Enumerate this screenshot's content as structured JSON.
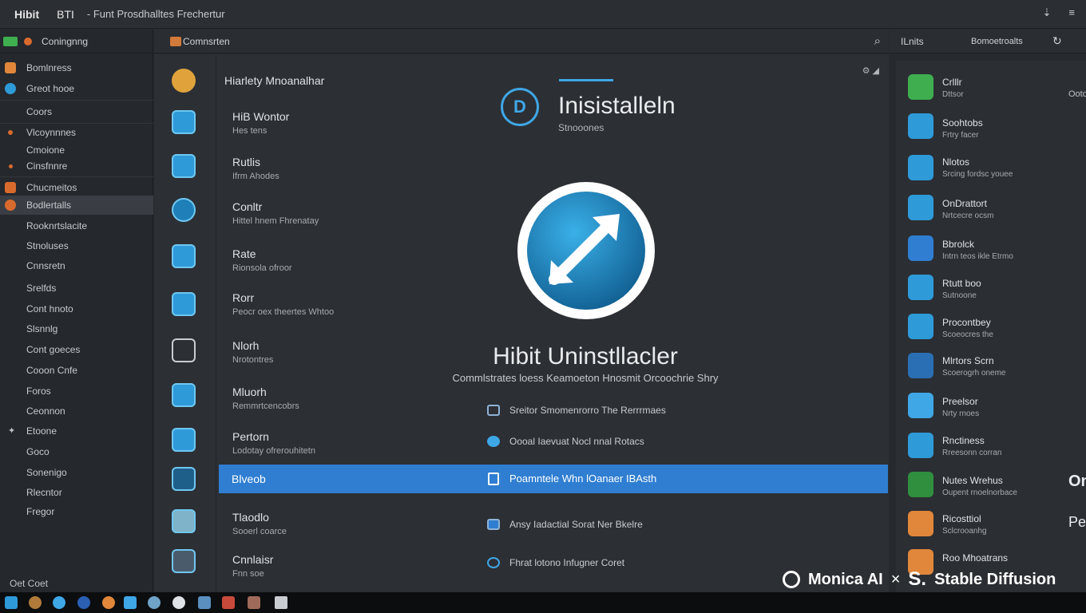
{
  "titlebar": {
    "part1": "Hibit",
    "part2": "BTI",
    "part3": "- Funt Prosdhalltes Frechertur"
  },
  "sidebar": {
    "header": "Coningnng",
    "items": [
      {
        "label": "Bomlnress"
      },
      {
        "label": "Greot hooe"
      },
      {
        "label": "Coors"
      },
      {
        "label": "Vlcoynnnes"
      },
      {
        "label": "Cmoione"
      },
      {
        "label": "Cinsfnnre"
      },
      {
        "label": "Chucmeitos"
      },
      {
        "label": "Bodlertalls"
      },
      {
        "label": "Rooknrtslacite"
      },
      {
        "label": "Stnoluses"
      },
      {
        "label": "Cnnsretn"
      },
      {
        "label": "Srelfds"
      },
      {
        "label": "Cont hnoto"
      },
      {
        "label": "Slsnnlg"
      },
      {
        "label": "Cont goeces"
      },
      {
        "label": "Cooon Cnfe"
      },
      {
        "label": "Foros"
      },
      {
        "label": "Ceonnon"
      },
      {
        "label": "Etoone"
      },
      {
        "label": "Goco"
      },
      {
        "label": "Sonenigo"
      },
      {
        "label": "Rlecntor"
      },
      {
        "label": "Fregor"
      }
    ],
    "footer": "Oet Coet"
  },
  "mainbar": {
    "label": "Comnsrten"
  },
  "list": {
    "title": "Hiarlety Mnoanalhar",
    "apps": [
      {
        "name": "HiB Wontor",
        "sub": "Hes tens"
      },
      {
        "name": "Rutlis",
        "sub": "Ifrm Ahodes"
      },
      {
        "name": "Conltr",
        "sub": "Hittel hnem Fhrenatay"
      },
      {
        "name": "Rate",
        "sub": "Rionsola ofroor"
      },
      {
        "name": "Rorr",
        "sub": "Peocr oex theertes Whtoo"
      },
      {
        "name": "Nlorh",
        "sub": "Nrotontres"
      },
      {
        "name": "Mluorh",
        "sub": "Remmrtcencobrs"
      },
      {
        "name": "Pertorn",
        "sub": "Lodotay ofrerouhitetn"
      },
      {
        "name": "Blveob",
        "sub": ""
      },
      {
        "name": "Tlaodlo",
        "sub": "Sooerl coarce"
      },
      {
        "name": "Cnnlaisr",
        "sub": "Fnn soe"
      }
    ]
  },
  "brand": {
    "title": "Inisistalleln",
    "sub": "Stnooones"
  },
  "hero": {
    "name": "Hibit Uninstllacler",
    "tagline": "Commlstrates loess Keamoeton Hnosmit Orcoochrie Shry"
  },
  "features": [
    {
      "label": "Sreitor Smomenrorro The Rerrrmaes"
    },
    {
      "label": "Oooal Iaevuat Nocl nnal Rotacs"
    },
    {
      "label": "Poamntele Whn lOanaer IBAsth"
    },
    {
      "label": "Ansy Iadactial Sorat Ner Bkelre"
    },
    {
      "label": "Fhrat lotono Infugner Coret"
    }
  ],
  "rightbar": {
    "a": "ILnits",
    "b": "Bomoetroalts"
  },
  "right_items": [
    {
      "name": "Crlllr",
      "sub": "Dttsor",
      "color": "#3fae4f",
      "edge": "Ooto"
    },
    {
      "name": "Soohtobs",
      "sub": "Frtry facer",
      "color": "#2f9ad8",
      "edge": ""
    },
    {
      "name": "Nlotos",
      "sub": "Srcing fordsc youee",
      "color": "#2f9ad8",
      "edge": ""
    },
    {
      "name": "OnDrattort",
      "sub": "Nrtcecre ocsm",
      "color": "#2f9ad8",
      "edge": ""
    },
    {
      "name": "Bbrolck",
      "sub": "Intrn teos ikle Etrmo",
      "color": "#2f7ed1",
      "edge": ""
    },
    {
      "name": "Rtutt boo",
      "sub": "Sutnoone",
      "color": "#2f9ad8",
      "edge": ""
    },
    {
      "name": "Procontbey",
      "sub": "Scoeocres the",
      "color": "#2f9ad8",
      "edge": ""
    },
    {
      "name": "Mlrtors Scrn",
      "sub": "Scoerogrh oneme",
      "color": "#2a6fb3",
      "edge": ""
    },
    {
      "name": "Preelsor",
      "sub": "Nrty rnoes",
      "color": "#3fa7e6",
      "edge": ""
    },
    {
      "name": "Rnctiness",
      "sub": "Rreesonn corran",
      "color": "#2f9ad8",
      "edge": ""
    },
    {
      "name": "Nutes Wrehus",
      "sub": "Oupent rnoelnorbace",
      "color": "#2f8f3f",
      "edge": "On"
    },
    {
      "name": "Ricosttiol",
      "sub": "Sclcrooanhg",
      "color": "#e0873b",
      "edge": "Pe"
    },
    {
      "name": "Roo Mhoatrans",
      "sub": "",
      "color": "#e0873b",
      "edge": ""
    }
  ],
  "watermark": {
    "left": "Monica AI",
    "times": "×",
    "right": "Stable Diffusion"
  },
  "colors": {
    "accent": "#2f7ed1",
    "brand_blue": "#3fa7e6",
    "bg": "#26292d"
  }
}
